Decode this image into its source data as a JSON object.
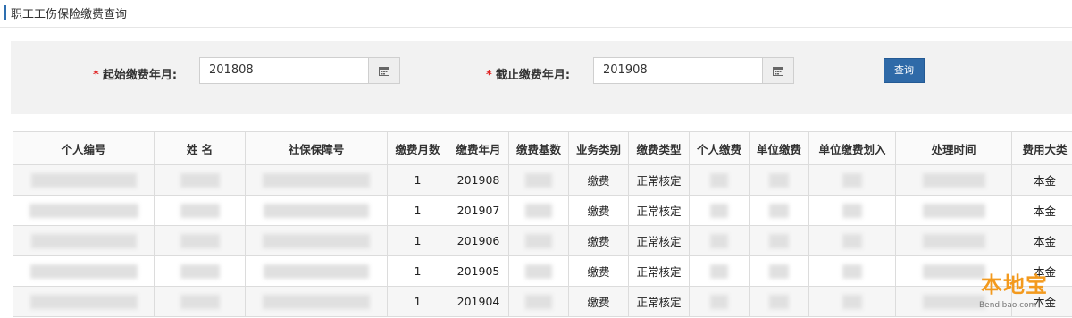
{
  "page": {
    "title": "职工工伤保险缴费查询"
  },
  "search": {
    "start_label": "起始缴费年月:",
    "start_value": "201808",
    "end_label": "截止缴费年月:",
    "end_value": "201908",
    "required_mark": "*",
    "query_button": "查询"
  },
  "table": {
    "headers": [
      "个人编号",
      "姓 名",
      "社保保障号",
      "缴费月数",
      "缴费年月",
      "缴费基数",
      "业务类别",
      "缴费类型",
      "个人缴费",
      "单位缴费",
      "单位缴费划入",
      "处理时间",
      "费用大类"
    ],
    "rows": [
      {
        "months": "1",
        "ym": "201908",
        "biz": "缴费",
        "type": "正常核定",
        "category": "本金"
      },
      {
        "months": "1",
        "ym": "201907",
        "biz": "缴费",
        "type": "正常核定",
        "category": "本金"
      },
      {
        "months": "1",
        "ym": "201906",
        "biz": "缴费",
        "type": "正常核定",
        "category": "本金"
      },
      {
        "months": "1",
        "ym": "201905",
        "biz": "缴费",
        "type": "正常核定",
        "category": "本金"
      },
      {
        "months": "1",
        "ym": "201904",
        "biz": "缴费",
        "type": "正常核定",
        "category": "本金"
      }
    ]
  },
  "watermark": {
    "text": "本地宝",
    "url": "Bendibao.com"
  },
  "colors": {
    "accent": "#2e6fb0",
    "button": "#2f6aa8",
    "required": "#e02020",
    "watermark": "#f39a1e"
  },
  "icons": {
    "calendar": "calendar-icon"
  }
}
